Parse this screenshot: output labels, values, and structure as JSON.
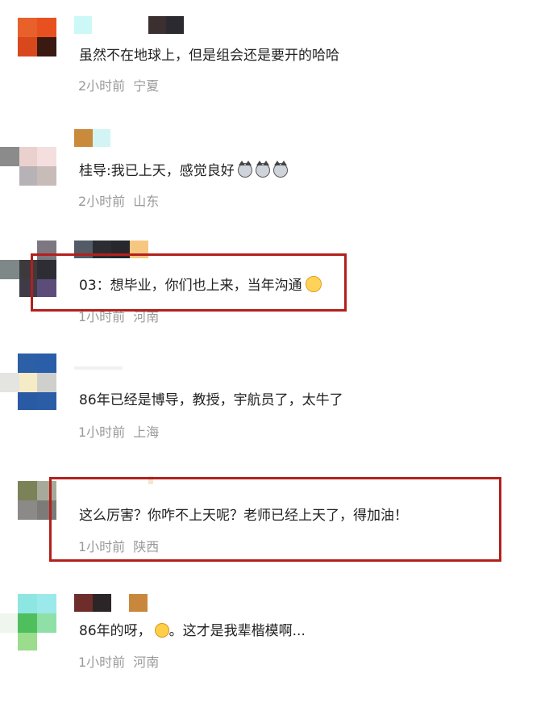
{
  "comments": [
    {
      "text": "虽然不在地球上，但是组会还是要开的哈哈",
      "time": "2小时前",
      "location": "宁夏"
    },
    {
      "text": "桂导:我已上天，感觉良好",
      "emoji_icons": [
        "cat-face-icon",
        "cat-face-icon",
        "cat-face-icon"
      ],
      "time": "2小时前",
      "location": "山东"
    },
    {
      "text": "03：想毕业，你们也上来，当年沟通",
      "emoji_icons": [
        "smile-face-icon"
      ],
      "time": "1小时前",
      "location": "河南",
      "highlighted": true
    },
    {
      "text": "86年已经是博导，教授，宇航员了，太牛了",
      "time": "1小时前",
      "location": "上海"
    },
    {
      "text": "这么厉害？你咋不上天呢？老师已经上天了，得加油！",
      "time": "1小时前",
      "location": "陕西",
      "highlighted": true
    },
    {
      "text_before": "86年的呀，",
      "emoji_icons": [
        "laughing-face-icon"
      ],
      "text_after": "。这才是我辈楷模啊...",
      "time": "1小时前",
      "location": "河南"
    }
  ],
  "colors": {
    "highlight_border": "#b3201c",
    "meta_text": "#9a9a9a",
    "comment_text": "#222222"
  }
}
